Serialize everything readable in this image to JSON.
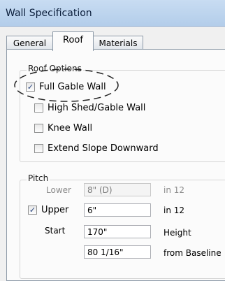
{
  "window": {
    "title": "Wall Specification"
  },
  "tabs": [
    {
      "label": "General"
    },
    {
      "label": "Roof"
    },
    {
      "label": "Materials"
    }
  ],
  "roof_options": {
    "legend": "Roof Options",
    "items": [
      {
        "label": "Full Gable Wall",
        "checked": true
      },
      {
        "label": "High Shed/Gable Wall",
        "checked": false
      },
      {
        "label": "Knee Wall",
        "checked": false
      },
      {
        "label": "Extend Slope Downward",
        "checked": false
      }
    ]
  },
  "pitch": {
    "legend": "Pitch",
    "lower_label": "Lower",
    "lower_value": "8\" (D)",
    "lower_unit": "in 12",
    "upper_label": "Upper",
    "upper_checked": true,
    "upper_value": "6\"",
    "upper_unit": "in 12",
    "start_label": "Start",
    "start_value": "170\"",
    "start_unit": "Height",
    "baseline_value": "80 1/16\"",
    "baseline_unit": "from Baseline"
  },
  "icons": {
    "check": "checkmark-icon"
  }
}
